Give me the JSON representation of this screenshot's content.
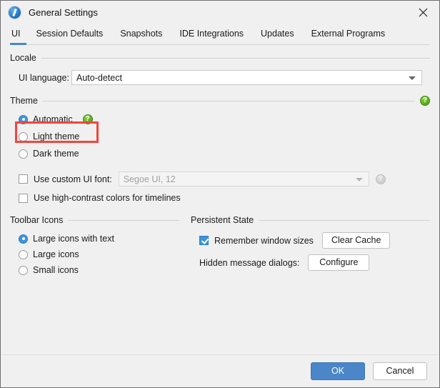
{
  "window": {
    "title": "General Settings",
    "app_icon": "jprofiler-icon",
    "close_label": "✕"
  },
  "tabs": [
    {
      "label": "UI",
      "active": true
    },
    {
      "label": "Session Defaults",
      "active": false
    },
    {
      "label": "Snapshots",
      "active": false
    },
    {
      "label": "IDE Integrations",
      "active": false
    },
    {
      "label": "Updates",
      "active": false
    },
    {
      "label": "External Programs",
      "active": false
    }
  ],
  "locale": {
    "group_title": "Locale",
    "ui_language_label": "UI language:",
    "ui_language_value": "Auto-detect",
    "ui_language_options": [
      "Auto-detect"
    ]
  },
  "theme": {
    "group_title": "Theme",
    "help_glyph": "?",
    "options": [
      {
        "label": "Automatic",
        "selected": true,
        "has_help": true,
        "highlighted": true
      },
      {
        "label": "Light theme",
        "selected": false,
        "has_help": false,
        "highlighted": false
      },
      {
        "label": "Dark theme",
        "selected": false,
        "has_help": false,
        "highlighted": false
      }
    ],
    "custom_font": {
      "checkbox_label": "Use custom UI font:",
      "checked": false,
      "value": "Segoe UI, 12",
      "enabled": false
    },
    "high_contrast": {
      "checkbox_label": "Use high-contrast colors for timelines",
      "checked": false
    }
  },
  "toolbar_icons": {
    "group_title": "Toolbar Icons",
    "options": [
      {
        "label": "Large icons with text",
        "selected": true
      },
      {
        "label": "Large icons",
        "selected": false
      },
      {
        "label": "Small icons",
        "selected": false
      }
    ]
  },
  "persistent_state": {
    "group_title": "Persistent State",
    "remember_label": "Remember window sizes",
    "remember_checked": true,
    "clear_cache_button": "Clear Cache",
    "hidden_dialogs_label": "Hidden message dialogs:",
    "configure_button": "Configure"
  },
  "footer": {
    "ok_label": "OK",
    "cancel_label": "Cancel"
  },
  "colors": {
    "accent": "#4a86c8",
    "help_green": "#5cae22",
    "highlight_red": "#f2453d",
    "background": "#f0f0f0"
  }
}
